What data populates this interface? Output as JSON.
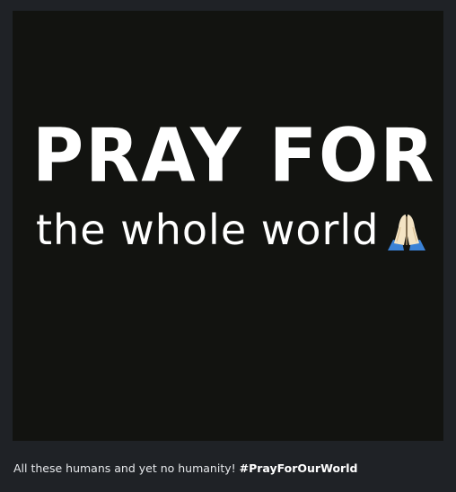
{
  "post": {
    "image": {
      "headline": "PRAY FOR",
      "subline": "the whole world",
      "emoji": "folded-hands-icon"
    },
    "caption": {
      "text": "All these humans and yet no humanity!",
      "hashtag": "#PrayForOurWorld"
    }
  },
  "colors": {
    "page_background": "#1f2226",
    "image_background": "#121310",
    "text": "#ffffff",
    "emoji_sleeve": "#3b82d6",
    "emoji_hands": "#f4e4c4"
  }
}
